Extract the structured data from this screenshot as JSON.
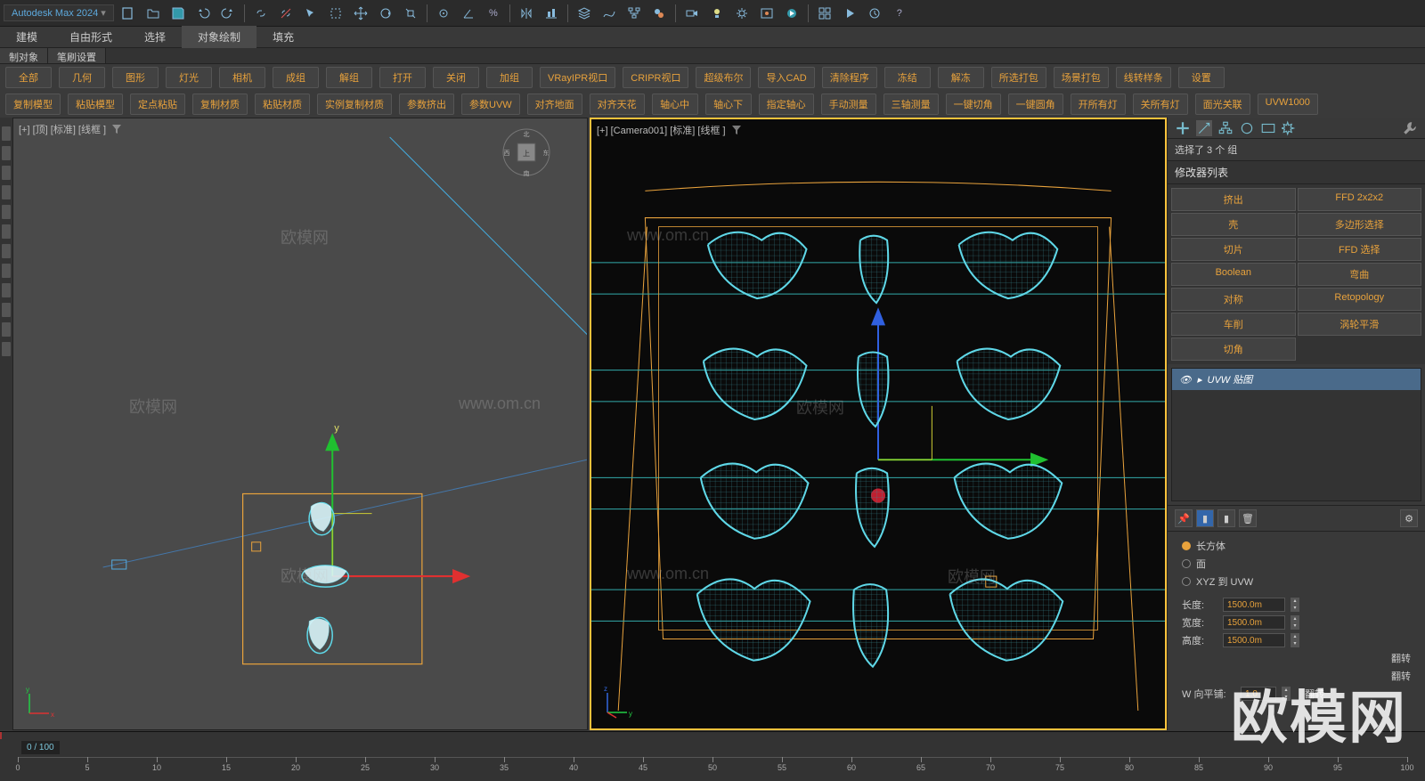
{
  "app": {
    "title": "Autodesk Max 2024",
    "title_suffix": "▾"
  },
  "ribbon_tabs": [
    "建模",
    "自由形式",
    "选择",
    "对象绘制",
    "填充"
  ],
  "ribbon_active_index": 3,
  "subtabs": [
    "制对象",
    "笔刷设置"
  ],
  "custom_row1": [
    "全部",
    "几何",
    "图形",
    "灯光",
    "相机",
    "成组",
    "解组",
    "打开",
    "关闭",
    "加组",
    "VRayIPR视口",
    "CRIPR视口",
    "超级布尔",
    "导入CAD",
    "清除程序",
    "冻结",
    "解冻",
    "所选打包",
    "场景打包",
    "线转样条",
    "设置"
  ],
  "custom_row2": [
    "复制模型",
    "粘贴模型",
    "定点粘贴",
    "复制材质",
    "粘贴材质",
    "实例复制材质",
    "参数挤出",
    "参数UVW",
    "对齐地面",
    "对齐天花",
    "轴心中",
    "轴心下",
    "指定轴心",
    "手动测量",
    "三轴测量",
    "一键切角",
    "一键圆角",
    "开所有灯",
    "关所有灯",
    "面光关联",
    "UVW1000"
  ],
  "viewport_left": {
    "label": "[+] [顶] [标准] [线框 ]"
  },
  "viewport_right": {
    "label": "[+] [Camera001] [标准] [线框 ]"
  },
  "right_panel": {
    "selection_info": "选择了 3 个 组",
    "modifier_list_label": "修改器列表",
    "modifiers": [
      [
        "挤出",
        "FFD 2x2x2"
      ],
      [
        "壳",
        "多边形选择"
      ],
      [
        "切片",
        "FFD 选择"
      ],
      [
        "Boolean",
        "弯曲"
      ],
      [
        "对称",
        "Retopology"
      ],
      [
        "车削",
        "涡轮平滑"
      ],
      [
        "切角",
        ""
      ]
    ],
    "stack_current": "UVW 贴图",
    "mapping": {
      "options": [
        "长方体",
        "面",
        "XYZ 到 UVW"
      ],
      "selected_index": 0,
      "length_label": "长度:",
      "length_value": "1500.0m",
      "width_label": "宽度:",
      "width_value": "1500.0m",
      "height_label": "高度:",
      "height_value": "1500.0m",
      "flip_label": "翻转",
      "tile_label": "W 向平铺:",
      "tile_value": "1.0"
    }
  },
  "timeline": {
    "frame_display": "0 / 100",
    "ticks": [
      0,
      5,
      10,
      15,
      20,
      25,
      30,
      35,
      40,
      45,
      50,
      55,
      60,
      65,
      70,
      75,
      80,
      85,
      90,
      95,
      100
    ]
  },
  "watermark_big": "欧模网",
  "watermark_small": "www.om.cn",
  "watermark_cn": "欧模网",
  "axis": {
    "x": "x",
    "y": "y",
    "z": "z"
  },
  "colors": {
    "accent_cyan": "#5fd8e8",
    "accent_orange": "#e8a23c",
    "gizmo_red": "#e03030",
    "gizmo_green": "#20c030",
    "gizmo_blue": "#3060e0",
    "selection_yellow": "#f9c23c"
  }
}
